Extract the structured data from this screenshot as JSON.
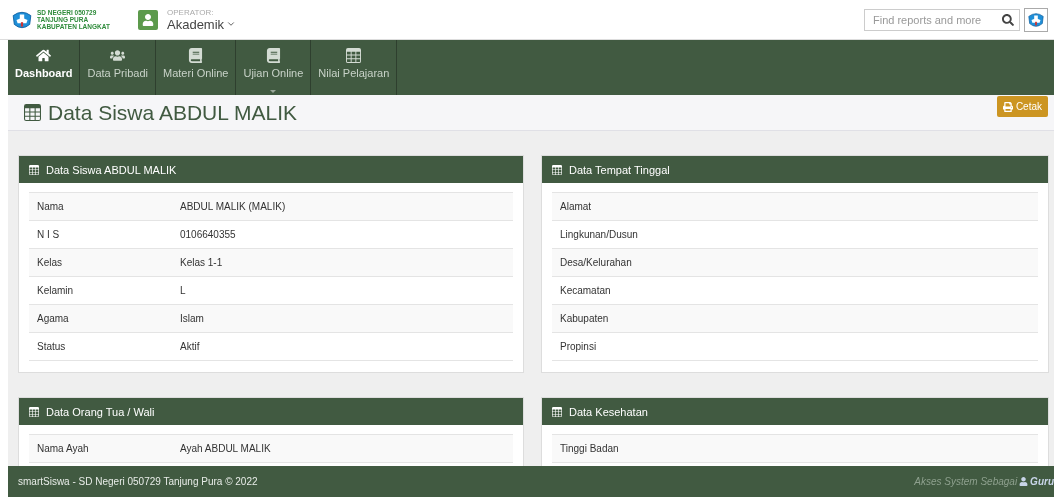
{
  "header": {
    "school_lines": [
      "SD NEGERI 050729",
      "TANJUNG PURA",
      "KABUPATEN LANGKAT"
    ],
    "role_caption": "OPERATOR:",
    "role_menu": "Akademik",
    "search": {
      "placeholder": "Find reports and more"
    }
  },
  "nav": [
    {
      "label": "Dashboard",
      "selected": true,
      "dropdown": false
    },
    {
      "label": "Data Pribadi",
      "selected": false,
      "dropdown": false
    },
    {
      "label": "Materi Online",
      "selected": false,
      "dropdown": false
    },
    {
      "label": "Ujian Online",
      "selected": false,
      "dropdown": true
    },
    {
      "label": "Nilai Pelajaran",
      "selected": false,
      "dropdown": false
    }
  ],
  "page_title": "Data Siswa ABDUL MALIK",
  "print_button": "Cetak",
  "panels": [
    {
      "title": "Data Siswa ABDUL MALIK",
      "rows": [
        {
          "label": "Nama",
          "value": "ABDUL MALIK (MALIK)"
        },
        {
          "label": "N I S",
          "value": "0106640355"
        },
        {
          "label": "Kelas",
          "value": "Kelas 1-1"
        },
        {
          "label": "Kelamin",
          "value": "L"
        },
        {
          "label": "Agama",
          "value": "Islam"
        },
        {
          "label": "Status",
          "value": "Aktif"
        }
      ]
    },
    {
      "title": "Data Tempat Tinggal",
      "rows": [
        {
          "label": "Alamat"
        },
        {
          "label": "Lingkunan/Dusun"
        },
        {
          "label": "Desa/Kelurahan"
        },
        {
          "label": "Kecamatan"
        },
        {
          "label": "Kabupaten"
        },
        {
          "label": "Propinsi"
        }
      ]
    },
    {
      "title": "Data Orang Tua / Wali",
      "rows": [
        {
          "label": "Nama Ayah",
          "value": "Ayah ABDUL MALIK"
        }
      ]
    },
    {
      "title": "Data Kesehatan",
      "rows": [
        {
          "label": "Tinggi Badan"
        }
      ]
    }
  ],
  "footer": {
    "text": "smartSiswa - SD Negeri 050729 Tanjung Pura © 2022",
    "access_label": "Akses System Sebagai",
    "access_role": "Guru"
  }
}
